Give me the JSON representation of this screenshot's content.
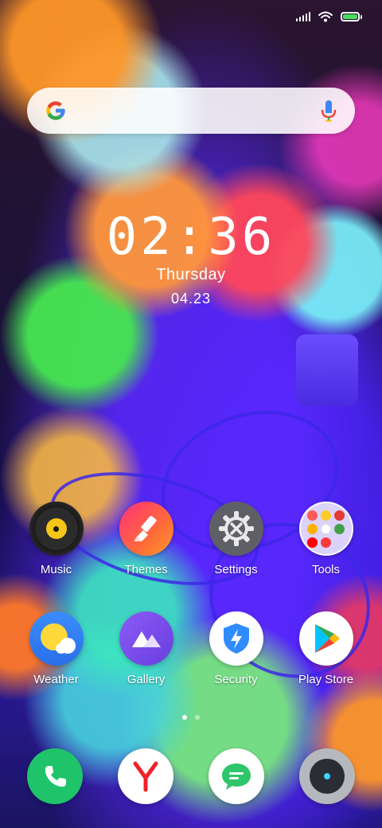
{
  "status_bar": {
    "icons": [
      "signal-icon",
      "wifi-icon",
      "battery-charging-icon"
    ],
    "battery_color": "#4cd964"
  },
  "search": {
    "logo": "google-logo",
    "mic_icon": "mic-icon"
  },
  "clock": {
    "time": "02:36",
    "day": "Thursday",
    "date": "04.23"
  },
  "apps": [
    {
      "label": "Music",
      "icon": "vinyl-record-icon"
    },
    {
      "label": "Themes",
      "icon": "paintbrush-icon"
    },
    {
      "label": "Settings",
      "icon": "gear-icon"
    },
    {
      "label": "Tools",
      "icon": "folder-icon"
    },
    {
      "label": "Weather",
      "icon": "sun-cloud-icon"
    },
    {
      "label": "Gallery",
      "icon": "mountains-icon"
    },
    {
      "label": "Security",
      "icon": "shield-bolt-icon"
    },
    {
      "label": "Play Store",
      "icon": "play-triangle-icon"
    }
  ],
  "dock": [
    {
      "icon": "phone-icon",
      "color": "#1fc46a"
    },
    {
      "icon": "yandex-y-icon",
      "color": "#ffffff"
    },
    {
      "icon": "message-bubble-icon",
      "color": "#ffffff"
    },
    {
      "icon": "camera-icon",
      "color": "#b5b8bd"
    }
  ],
  "page_indicator": {
    "pages": 2,
    "current": 1
  },
  "colors": {
    "accent_white": "#ffffff",
    "google_blue": "#4285f4",
    "google_red": "#ea4335",
    "google_yellow": "#fbbc05",
    "google_green": "#34a853"
  }
}
